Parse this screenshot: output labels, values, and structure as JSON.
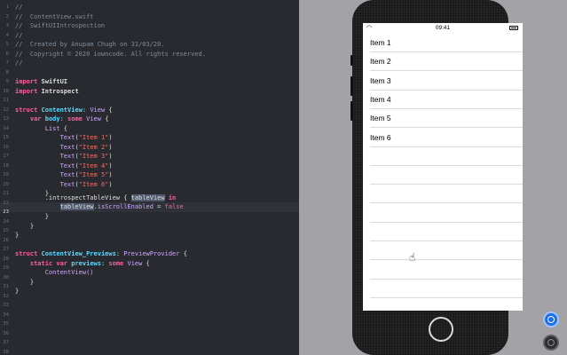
{
  "editor": {
    "line_numbers": [
      "1",
      "2",
      "3",
      "4",
      "5",
      "6",
      "7",
      "8",
      "9",
      "10",
      "11",
      "12",
      "13",
      "14",
      "15",
      "16",
      "17",
      "18",
      "19",
      "20",
      "21",
      "22",
      "23",
      "24",
      "25",
      "26",
      "27",
      "28",
      "29",
      "30",
      "31",
      "32",
      "33",
      "34",
      "35",
      "36",
      "37",
      "38"
    ],
    "current_line": "23",
    "lines": {
      "l1": "//",
      "l2": "//  ContentView.swift",
      "l3": "//  SwiftUIIntrospection",
      "l4": "//",
      "l5": "//  Created by Anupam Chugh on 31/03/20.",
      "l6": "//  Copyright © 2020 iowncode. All rights reserved.",
      "l7": "//",
      "l9_kw": "import",
      "l9_name": "SwiftUI",
      "l10_kw": "import",
      "l10_name": "Introspect",
      "l12_kw": "struct",
      "l12_name": "ContentView",
      "l12_colon": ":",
      "l12_type": "View",
      "l12_brace": "{",
      "l13_kw": "var",
      "l13_name": "body",
      "l13_colon": ":",
      "l13_kw2": "some",
      "l13_type": "View",
      "l13_brace": "{",
      "l14_type": "List",
      "l14_brace": "{",
      "text_fn": "Text",
      "items": [
        "Item 1",
        "Item 2",
        "Item 3",
        "Item 4",
        "Item 5",
        "Item 6"
      ],
      "l21": "}",
      "l22_method": ".introspectTableView",
      "l22_brace": "{",
      "l22_param": "tableView",
      "l22_in": "in",
      "l23_obj": "tableView",
      "l23_prop": ".isScrollEnabled",
      "l23_eq": "=",
      "l23_val": "false",
      "l24": "}",
      "l25": "}",
      "l26": "}",
      "l28_kw": "struct",
      "l28_name": "ContentView_Previews",
      "l28_colon": ":",
      "l28_type": "PreviewProvider",
      "l28_brace": "{",
      "l29_kw": "static",
      "l29_kw2": "var",
      "l29_name": "previews",
      "l29_colon": ":",
      "l29_kw3": "some",
      "l29_type": "View",
      "l29_brace": "{",
      "l30_call": "ContentView()",
      "l31": "}",
      "l32": "}"
    }
  },
  "preview": {
    "status_time": "09:41",
    "list_items": [
      "Item 1",
      "Item 2",
      "Item 3",
      "Item 4",
      "Item 5",
      "Item 6"
    ],
    "empty_rows": 8,
    "live_button_icon": "live-preview-icon",
    "preview_button_icon": "preview-icon",
    "accent": "#1c6fe5"
  }
}
